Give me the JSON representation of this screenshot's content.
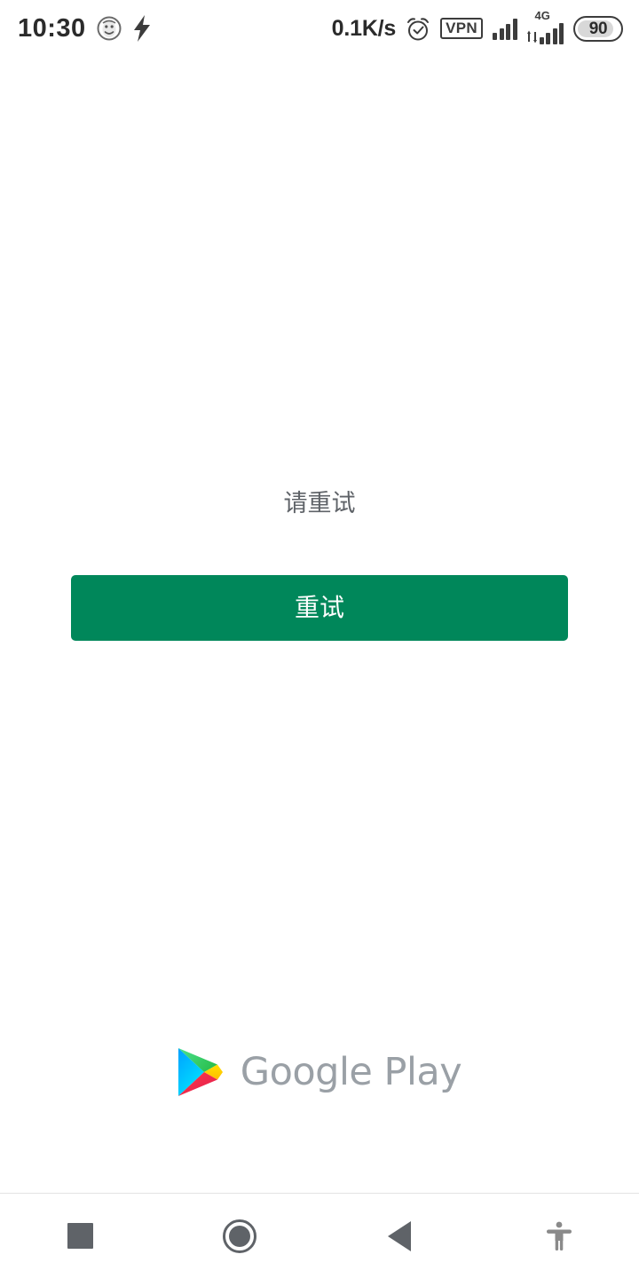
{
  "statusbar": {
    "time": "10:30",
    "emoji_icon": "face-emoji-icon",
    "charging_icon": "lightning-bolt-icon",
    "net_speed": "0.1K/s",
    "alarm_icon": "alarm-clock-icon",
    "vpn_label": "VPN",
    "signal_icon": "signal-bars-icon",
    "network_type": "4G",
    "data_arrows_icon": "data-transfer-arrows-icon",
    "battery_level": "90"
  },
  "main": {
    "error_message": "请重试",
    "retry_button_label": "重试",
    "retry_button_color": "#00875A",
    "message_color": "#5f6368"
  },
  "branding": {
    "logo_icon": "google-play-triangle-icon",
    "name": "Google Play",
    "text_color": "#9aa0a6"
  },
  "navbar": {
    "recents_icon": "square-recents-icon",
    "home_icon": "circle-home-icon",
    "back_icon": "triangle-back-icon",
    "accessibility_icon": "accessibility-person-icon",
    "icon_color": "#5f6368"
  }
}
